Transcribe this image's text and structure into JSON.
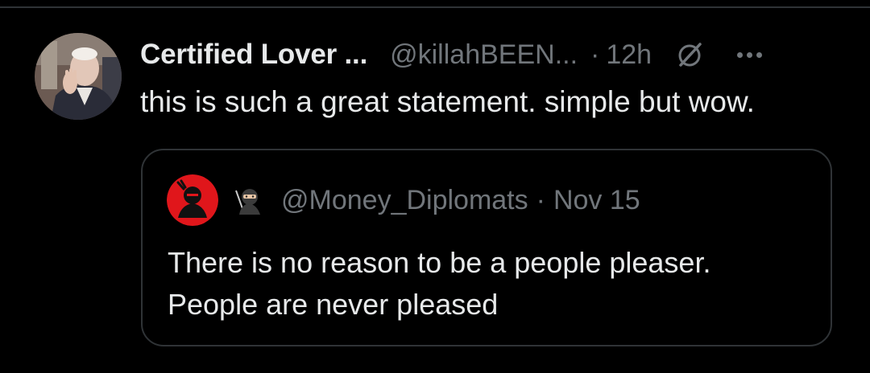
{
  "tweet": {
    "display_name": "Certified Lover ...",
    "handle": "@killahBEEN...",
    "separator": "·",
    "time": "12h",
    "text": "this is such a great statement. simple but wow.",
    "avatar_icon": "profile-photo",
    "status_icon": "unavailable-icon",
    "more_icon": "more-options-icon"
  },
  "quoted_tweet": {
    "avatar_icon": "red-ninja-avatar",
    "emoji_icon": "ninja-emoji-icon",
    "handle": "@Money_Diplomats",
    "separator": "·",
    "date": "Nov 15",
    "text_lines": [
      "There is no reason to be a people pleaser.",
      "People are never pleased"
    ]
  },
  "colors": {
    "background": "#000000",
    "primary_text": "#e7e9ea",
    "secondary_text": "#71767b",
    "border": "#2f3336",
    "avatar_red": "#e0161b"
  }
}
